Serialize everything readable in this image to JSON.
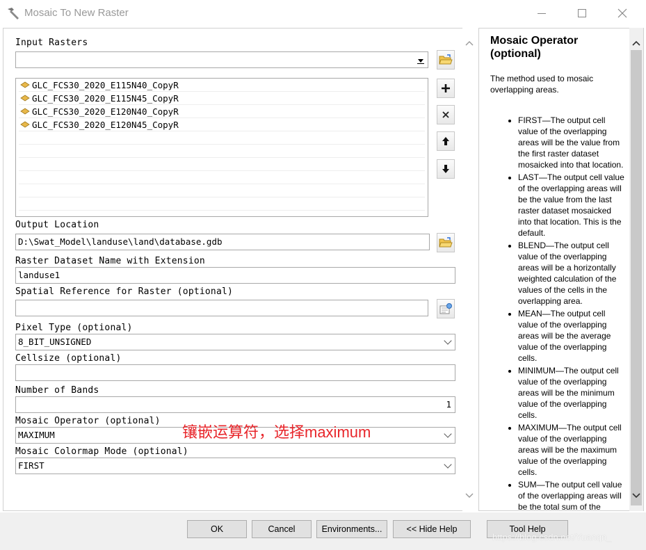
{
  "window": {
    "title": "Mosaic To New Raster"
  },
  "form": {
    "input_rasters_label": "Input Rasters",
    "input_rasters_value": "",
    "rasters": [
      "GLC_FCS30_2020_E115N40_CopyR",
      "GLC_FCS30_2020_E115N45_CopyR",
      "GLC_FCS30_2020_E120N40_CopyR",
      "GLC_FCS30_2020_E120N45_CopyR"
    ],
    "output_location_label": "Output Location",
    "output_location_value": "D:\\Swat_Model\\landuse\\land\\database.gdb",
    "raster_name_label": "Raster Dataset Name with Extension",
    "raster_name_value": "landuse1",
    "spatial_ref_label": "Spatial Reference for Raster (optional)",
    "spatial_ref_value": "",
    "pixel_type_label": "Pixel Type (optional)",
    "pixel_type_value": "8_BIT_UNSIGNED",
    "cellsize_label": "Cellsize (optional)",
    "cellsize_value": "",
    "bands_label": "Number of Bands",
    "bands_value": "1",
    "mosaic_operator_label": "Mosaic Operator (optional)",
    "mosaic_operator_value": "MAXIMUM",
    "colormap_label": "Mosaic Colormap Mode (optional)",
    "colormap_value": "FIRST",
    "annotation": "镶嵌运算符，选择maximum"
  },
  "help": {
    "title": "Mosaic Operator (optional)",
    "description": "The method used to mosaic overlapping areas.",
    "items": [
      "FIRST—The output cell value of the overlapping areas will be the value from the first raster dataset mosaicked into that location.",
      "LAST—The output cell value of the overlapping areas will be the value from the last raster dataset mosaicked into that location. This is the default.",
      "BLEND—The output cell value of the overlapping areas will be a horizontally weighted calculation of the values of the cells in the overlapping area.",
      "MEAN—The output cell value of the overlapping areas will be the average value of the overlapping cells.",
      "MINIMUM—The output cell value of the overlapping areas will be the minimum value of the overlapping cells.",
      "MAXIMUM—The output cell value of the overlapping areas will be the maximum value of the overlapping cells.",
      "SUM—The output cell value of the overlapping areas will be the total sum of the overlapping cells."
    ]
  },
  "buttons": {
    "ok": "OK",
    "cancel": "Cancel",
    "environments": "Environments...",
    "hide_help": "<< Hide Help",
    "tool_help": "Tool Help"
  },
  "watermark": "https://blog.csdn.net/Yuanqn_",
  "colors": {
    "annotation": "#e8262b",
    "button_bg": "#e1e1e1",
    "bar_bg": "#f0f0f0"
  }
}
